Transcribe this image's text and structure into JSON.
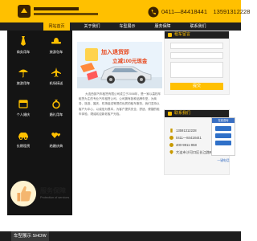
{
  "header": {
    "logo_text": "",
    "phone_numbers": "0411—84418441　13591312228"
  },
  "nav": {
    "items": [
      {
        "label": "网站首页",
        "active": true
      },
      {
        "label": "关于我们",
        "active": false
      },
      {
        "label": "车型展示",
        "active": false
      },
      {
        "label": "服务保障",
        "active": false
      },
      {
        "label": "联系我们",
        "active": false
      }
    ]
  },
  "sidebar": {
    "tiles": [
      {
        "label": "商务用车",
        "icon": "tie-icon"
      },
      {
        "label": "旅游包车",
        "icon": "hat-icon"
      },
      {
        "label": "旅游用车",
        "icon": "umbrella-icon"
      },
      {
        "label": "机场接送",
        "icon": "plane-icon"
      },
      {
        "label": "个人婚庆",
        "icon": "calendar-icon"
      },
      {
        "label": "婚礼用车",
        "icon": "ring-icon"
      },
      {
        "label": "长期租赁",
        "icon": "car-icon"
      },
      {
        "label": "结婚庆典",
        "icon": "hearts-icon"
      }
    ]
  },
  "banner": {
    "line1": "加入退货即",
    "line2": "立减100元现金"
  },
  "about": {
    "text": "大连西部汽车租赁有限公司成立于2008年，是一家以高档车租赁为主的专业汽车租赁公司，公司拥有各种品牌车型，为商务、旅游、婚庆、机场接送等提供优质的租车服务，我们坚持以客户为中心，以诚信为根本，为客户提供安全、舒适、便捷的租车体验，竭诚欢迎新老客户光临。"
  },
  "service": {
    "title": "服务保障",
    "subtitle": "Protection of services"
  },
  "booking": {
    "title": "租车留言",
    "submit_label": "提交"
  },
  "contact": {
    "title": "联系我们",
    "rows": [
      {
        "text": "13591312228",
        "icon": "mobile-icon"
      },
      {
        "text": "0411—84418441",
        "icon": "phone-icon"
      },
      {
        "text": "400-9911-958",
        "icon": "phone-icon"
      },
      {
        "text": "大连市沙河口区长江路881号",
        "icon": "location-icon"
      }
    ]
  },
  "float": {
    "online_label": "在线咨询",
    "top_label": "一键电话"
  },
  "bottom": {
    "tab_label": "车型展示 SHOW"
  },
  "colors": {
    "accent": "#ffc000",
    "dark": "#141414",
    "online": "#3a6fc2"
  }
}
